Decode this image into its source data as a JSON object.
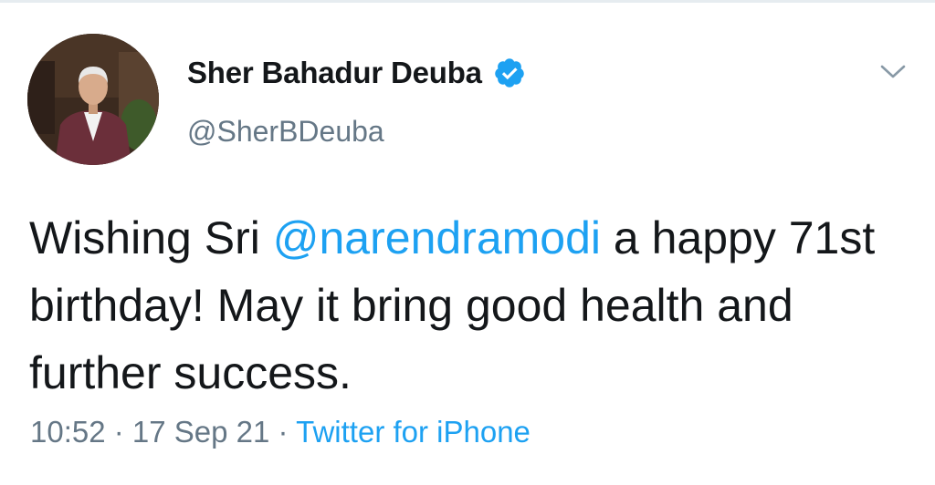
{
  "user": {
    "display_name": "Sher Bahadur Deuba",
    "handle": "@SherBDeuba",
    "verified": true
  },
  "tweet": {
    "text_before": "Wishing Sri ",
    "mention": "@narendramodi",
    "text_after": " a happy 71st birthday! May it bring good health and further success."
  },
  "meta": {
    "time": "10:52",
    "separator": " · ",
    "date": "17 Sep 21",
    "source": "Twitter for iPhone"
  },
  "colors": {
    "accent": "#1da1f2",
    "text": "#14171a",
    "secondary": "#657786"
  },
  "icons": {
    "verified": "verified-badge-icon",
    "menu": "chevron-down-icon"
  }
}
